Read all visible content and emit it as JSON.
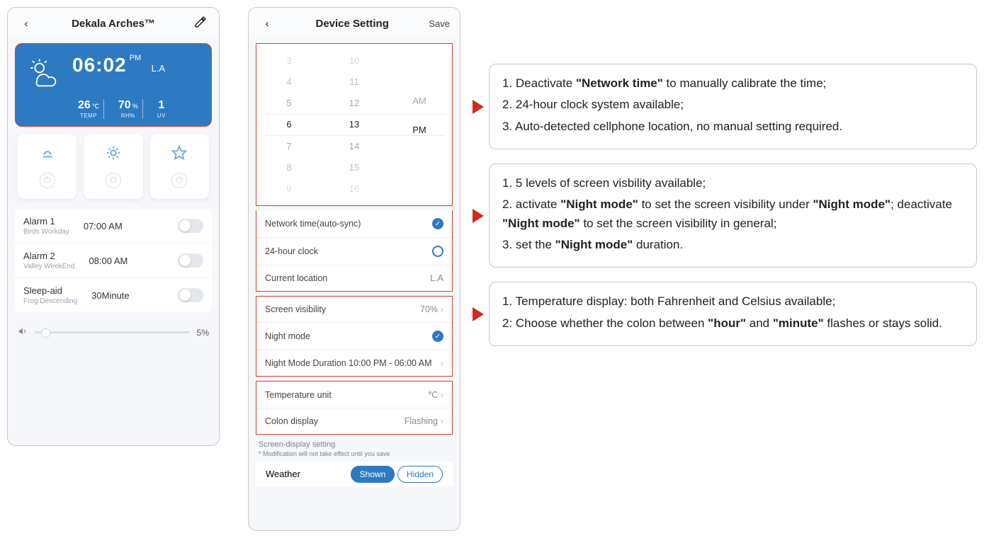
{
  "phone1": {
    "title": "Dekala Arches™",
    "weather": {
      "time": "06:02",
      "ampm": "PM",
      "location": "L.A",
      "temp_value": "26",
      "temp_unit": "℃",
      "temp_label": "TEMP",
      "rh_value": "70",
      "rh_unit": "%",
      "rh_label": "RH%",
      "uv_value": "1",
      "uv_label": "UV"
    },
    "alarms": {
      "a1_name": "Alarm 1",
      "a1_time": "07:00 AM",
      "a1_sub": "Birds Workday",
      "a2_name": "Alarm 2",
      "a2_time": "08:00 AM",
      "a2_sub": "Valley WeekEnd",
      "sleep_name": "Sleep-aid",
      "sleep_time": "30Minute",
      "sleep_sub": "Frog Descending"
    },
    "volume_label": "5%"
  },
  "phone2": {
    "title": "Device Setting",
    "save": "Save",
    "picker_hours": [
      "3",
      "4",
      "5",
      "6",
      "7",
      "8",
      "9"
    ],
    "picker_minutes": [
      "10",
      "11",
      "12",
      "13",
      "14",
      "15",
      "16"
    ],
    "picker_ampm_am": "AM",
    "picker_ampm_pm": "PM",
    "g1": {
      "network": "Network time(auto-sync)",
      "h24": "24-hour clock",
      "loc": "Current location",
      "loc_val": "L.A"
    },
    "g2": {
      "vis": "Screen visibility",
      "vis_val": "70%",
      "night": "Night mode",
      "dur": "Night Mode Duration 10:00 PM - 06:00 AM"
    },
    "g3": {
      "temp": "Temperature unit",
      "temp_val": "℃",
      "colon": "Colon display",
      "colon_val": "Flashing"
    },
    "note_title": "Screen-display setting",
    "note_sub": "* Modification will not take effect until you save",
    "weather_label": "Weather",
    "shown": "Shown",
    "hidden": "Hidden"
  },
  "ann": {
    "c1_l1_a": "1. Deactivate ",
    "c1_l1_b": "\"Network time\"",
    "c1_l1_c": " to manually calibrate the time;",
    "c1_l2": "2. 24-hour clock system available;",
    "c1_l3": "3. Auto-detected cellphone location, no manual setting required.",
    "c2_l1": "1. 5 levels of screen visbility available;",
    "c2_l2_a": "2. activate ",
    "c2_l2_b": "\"Night mode\"",
    "c2_l2_c": " to set the screen visibility under ",
    "c2_l2_d": "\"Night mode\"",
    "c2_l2_e": "; deactivate ",
    "c2_l2_f": "\"Night mode\"",
    "c2_l2_g": " to set the screen visibility in general;",
    "c2_l3_a": "3. set the ",
    "c2_l3_b": "\"Night mode\"",
    "c2_l3_c": " duration.",
    "c3_l1": "1. Temperature display: both Fahrenheit and Celsius available;",
    "c3_l2_a": "2: Choose whether the colon between ",
    "c3_l2_b": "\"hour\"",
    "c3_l2_c": " and ",
    "c3_l2_d": "\"minute\"",
    "c3_l2_e": " flashes or stays solid."
  }
}
